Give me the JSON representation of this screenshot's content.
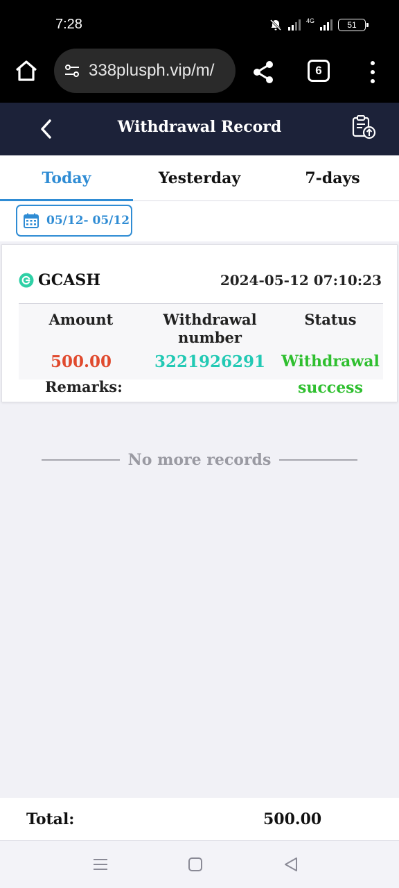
{
  "status_bar": {
    "time": "7:28",
    "network": "4G",
    "battery": "51",
    "icons": [
      "bell-muted-icon",
      "signal-icon",
      "signal-4g-icon",
      "battery-icon"
    ]
  },
  "browser": {
    "url": "338plusph.vip/m/",
    "tab_count": "6",
    "icons": [
      "home-icon",
      "site-settings-icon",
      "share-icon",
      "tabs-icon",
      "more-vert-icon"
    ]
  },
  "header": {
    "title": "Withdrawal Record",
    "icons": [
      "back-arrow-icon",
      "clipboard-upload-icon"
    ]
  },
  "tabs": [
    {
      "label": "Today",
      "active": true
    },
    {
      "label": "Yesterday",
      "active": false
    },
    {
      "label": "7-days",
      "active": false
    }
  ],
  "date_filter": {
    "label": "05/12- 05/12",
    "icon": "calendar-icon"
  },
  "record": {
    "method": "GCASH",
    "method_icon": "gcash-icon",
    "datetime": "2024-05-12 07:10:23",
    "headers": {
      "amount": "Amount",
      "number_line1": "Withdrawal",
      "number_line2": "number",
      "status": "Status"
    },
    "amount": "500.00",
    "withdrawal_number": "3221926291",
    "status_line1": "Withdrawal",
    "status_line2": "success",
    "remarks_label": "Remarks:"
  },
  "no_more_text": "No more records",
  "total": {
    "label": "Total:",
    "value": "500.00"
  },
  "colors": {
    "header_bg": "#1c2239",
    "accent": "#2f8cd4",
    "amount": "#e04a2e",
    "number": "#22c9b4",
    "status": "#2fbf2f"
  }
}
